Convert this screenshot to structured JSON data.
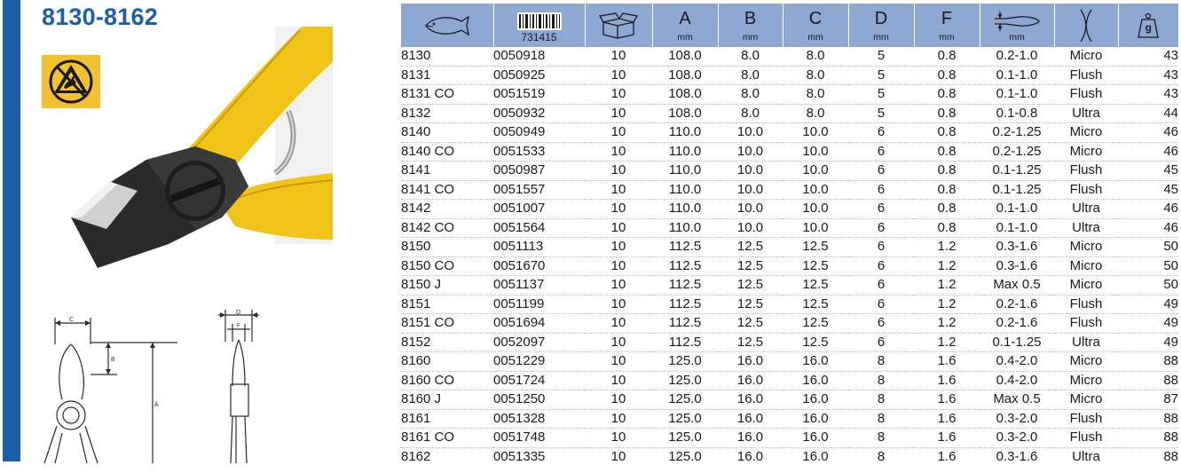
{
  "product": {
    "title": "8130-8162"
  },
  "icons": {
    "esd_badge": "esd-warning-icon",
    "fish": "fish-icon",
    "barcode": "barcode-icon",
    "box": "box-icon",
    "jaw_capacity": "wire-capacity-icon",
    "cut_type": "cutting-edge-icon",
    "weight": "weight-icon"
  },
  "colors": {
    "brand_blue": "#1d5ea8",
    "header_bg": "#8ea8d4",
    "esd_yellow": "#f2c230",
    "handle_yellow": "#f0c419"
  },
  "table": {
    "columns": [
      {
        "key": "model",
        "label": "",
        "unit": ""
      },
      {
        "key": "code",
        "label": "731415",
        "unit": ""
      },
      {
        "key": "pack",
        "label": "",
        "unit": ""
      },
      {
        "key": "a",
        "label": "A",
        "unit": "mm"
      },
      {
        "key": "b",
        "label": "B",
        "unit": "mm"
      },
      {
        "key": "c",
        "label": "C",
        "unit": "mm"
      },
      {
        "key": "d",
        "label": "D",
        "unit": "mm"
      },
      {
        "key": "f",
        "label": "F",
        "unit": "mm"
      },
      {
        "key": "cap",
        "label": "",
        "unit": "mm"
      },
      {
        "key": "edge",
        "label": "",
        "unit": ""
      },
      {
        "key": "weight",
        "label": "g",
        "unit": ""
      }
    ],
    "rows": [
      [
        "8130",
        "0050918",
        "10",
        "108.0",
        "8.0",
        "8.0",
        "5",
        "0.8",
        "0.2-1.0",
        "Micro",
        "43"
      ],
      [
        "8131",
        "0050925",
        "10",
        "108.0",
        "8.0",
        "8.0",
        "5",
        "0.8",
        "0.1-1.0",
        "Flush",
        "43"
      ],
      [
        "8131 CO",
        "0051519",
        "10",
        "108.0",
        "8.0",
        "8.0",
        "5",
        "0.8",
        "0.1-1.0",
        "Flush",
        "43"
      ],
      [
        "8132",
        "0050932",
        "10",
        "108.0",
        "8.0",
        "8.0",
        "5",
        "0.8",
        "0.1-0.8",
        "Ultra",
        "44"
      ],
      [
        "8140",
        "0050949",
        "10",
        "110.0",
        "10.0",
        "10.0",
        "6",
        "0.8",
        "0.2-1.25",
        "Micro",
        "46"
      ],
      [
        "8140 CO",
        "0051533",
        "10",
        "110.0",
        "10.0",
        "10.0",
        "6",
        "0.8",
        "0.2-1.25",
        "Micro",
        "46"
      ],
      [
        "8141",
        "0050987",
        "10",
        "110.0",
        "10.0",
        "10.0",
        "6",
        "0.8",
        "0.1-1.25",
        "Flush",
        "45"
      ],
      [
        "8141 CO",
        "0051557",
        "10",
        "110.0",
        "10.0",
        "10.0",
        "6",
        "0.8",
        "0.1-1.25",
        "Flush",
        "45"
      ],
      [
        "8142",
        "0051007",
        "10",
        "110.0",
        "10.0",
        "10.0",
        "6",
        "0.8",
        "0.1-1.0",
        "Ultra",
        "46"
      ],
      [
        "8142 CO",
        "0051564",
        "10",
        "110.0",
        "10.0",
        "10.0",
        "6",
        "0.8",
        "0.1-1.0",
        "Ultra",
        "46"
      ],
      [
        "8150",
        "0051113",
        "10",
        "112.5",
        "12.5",
        "12.5",
        "6",
        "1.2",
        "0.3-1.6",
        "Micro",
        "50"
      ],
      [
        "8150 CO",
        "0051670",
        "10",
        "112.5",
        "12.5",
        "12.5",
        "6",
        "1.2",
        "0.3-1.6",
        "Micro",
        "50"
      ],
      [
        "8150 J",
        "0051137",
        "10",
        "112.5",
        "12.5",
        "12.5",
        "6",
        "1.2",
        "Max 0.5",
        "Micro",
        "50"
      ],
      [
        "8151",
        "0051199",
        "10",
        "112.5",
        "12.5",
        "12.5",
        "6",
        "1.2",
        "0.2-1.6",
        "Flush",
        "49"
      ],
      [
        "8151 CO",
        "0051694",
        "10",
        "112.5",
        "12.5",
        "12.5",
        "6",
        "1.2",
        "0.2-1.6",
        "Flush",
        "49"
      ],
      [
        "8152",
        "0052097",
        "10",
        "112.5",
        "12.5",
        "12.5",
        "6",
        "1.2",
        "0.1-1.25",
        "Ultra",
        "49"
      ],
      [
        "8160",
        "0051229",
        "10",
        "125.0",
        "16.0",
        "16.0",
        "8",
        "1.6",
        "0.4-2.0",
        "Micro",
        "88"
      ],
      [
        "8160 CO",
        "0051724",
        "10",
        "125.0",
        "16.0",
        "16.0",
        "8",
        "1.6",
        "0.4-2.0",
        "Micro",
        "88"
      ],
      [
        "8160 J",
        "0051250",
        "10",
        "125.0",
        "16.0",
        "16.0",
        "8",
        "1.6",
        "Max 0.5",
        "Micro",
        "87"
      ],
      [
        "8161",
        "0051328",
        "10",
        "125.0",
        "16.0",
        "16.0",
        "8",
        "1.6",
        "0.3-2.0",
        "Flush",
        "88"
      ],
      [
        "8161 CO",
        "0051748",
        "10",
        "125.0",
        "16.0",
        "16.0",
        "8",
        "1.6",
        "0.3-2.0",
        "Flush",
        "88"
      ],
      [
        "8162",
        "0051335",
        "10",
        "125.0",
        "16.0",
        "16.0",
        "8",
        "1.6",
        "0.3-1.6",
        "Ultra",
        "88"
      ]
    ]
  }
}
